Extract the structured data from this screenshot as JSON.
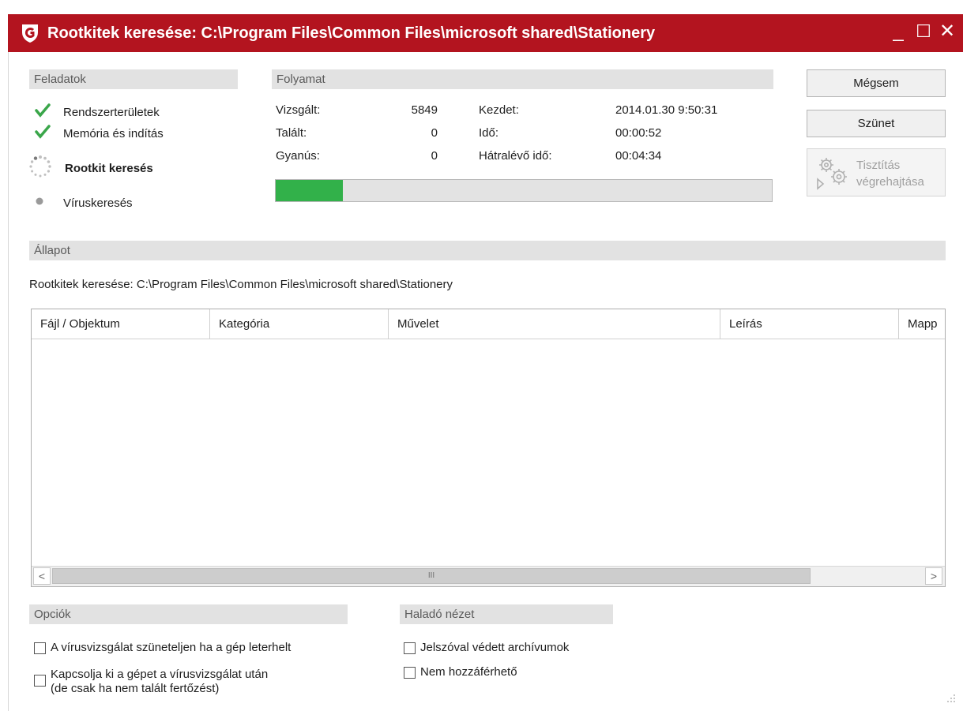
{
  "window": {
    "title": "Rootkitek keresése: C:\\Program Files\\Common Files\\microsoft shared\\Stationery",
    "controls": {
      "minimize": "_",
      "maximize": "☐",
      "close": "✕"
    },
    "accent_color": "#b3141f"
  },
  "tasks": {
    "header": "Feladatok",
    "items": [
      {
        "label": "Rendszerterületek",
        "state": "done",
        "icon": "check-icon"
      },
      {
        "label": "Memória és indítás",
        "state": "done",
        "icon": "check-icon"
      },
      {
        "label": "Rootkit keresés",
        "state": "active",
        "icon": "spinner-icon"
      },
      {
        "label": "Víruskeresés",
        "state": "pending",
        "icon": "dot-icon"
      }
    ]
  },
  "progress": {
    "header": "Folyamat",
    "scanned_label": "Vizsgált:",
    "scanned_value": "5849",
    "found_label": "Talált:",
    "found_value": "0",
    "suspicious_label": "Gyanús:",
    "suspicious_value": "0",
    "start_label": "Kezdet:",
    "start_value": "2014.01.30 9:50:31",
    "time_label": "Idő:",
    "time_value": "00:00:52",
    "remaining_label": "Hátralévő idő:",
    "remaining_value": "00:04:34",
    "fraction": 0.135,
    "bar_color": "#32b14a"
  },
  "buttons": {
    "cancel": "Mégsem",
    "pause": "Szünet",
    "clean_line1": "Tisztítás",
    "clean_line2": "végrehajtása"
  },
  "status": {
    "header": "Állapot",
    "text": "Rootkitek keresése: C:\\Program Files\\Common Files\\microsoft shared\\Stationery"
  },
  "table": {
    "columns": [
      "Fájl / Objektum",
      "Kategória",
      "Művelet",
      "Leírás",
      "Mapp"
    ],
    "rows": [],
    "scroll_left": "<",
    "scroll_right": ">",
    "scroll_grip": "III"
  },
  "options": {
    "header": "Opciók",
    "items": [
      {
        "label": "A vírusvizsgálat szüneteljen ha a gép leterhelt",
        "checked": false
      },
      {
        "label": "Kapcsolja ki a gépet a vírusvizsgálat után\n(de csak ha nem talált fertőzést)",
        "checked": false
      }
    ]
  },
  "advanced": {
    "header": "Haladó nézet",
    "items": [
      {
        "label": "Jelszóval védett archívumok",
        "checked": false
      },
      {
        "label": "Nem hozzáférhető",
        "checked": false
      }
    ]
  }
}
